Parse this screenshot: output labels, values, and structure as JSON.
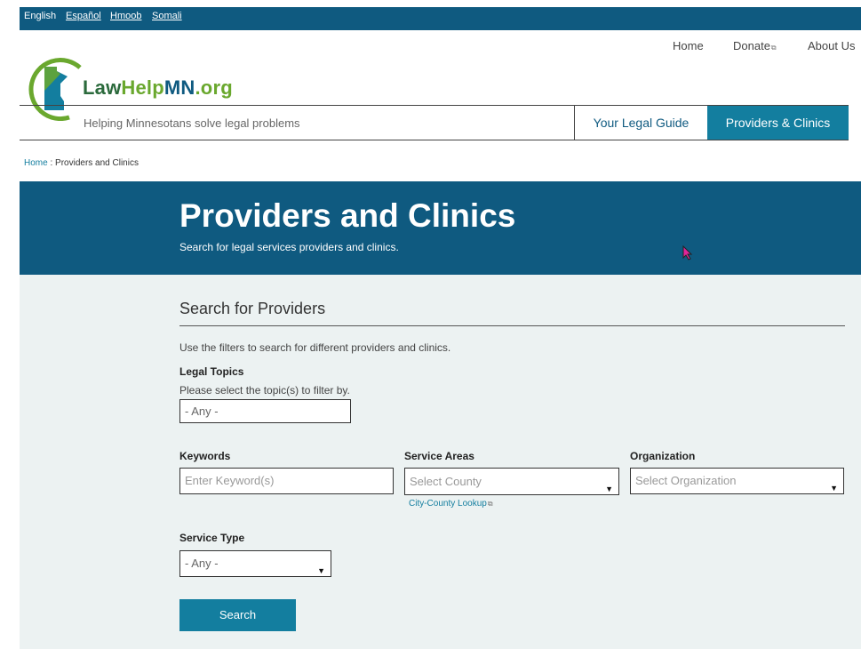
{
  "languages": [
    {
      "label": "English"
    },
    {
      "label": "Español"
    },
    {
      "label": "Hmoob"
    },
    {
      "label": "Somali"
    }
  ],
  "topnav": {
    "home": "Home",
    "donate": "Donate",
    "about": "About Us"
  },
  "brand": {
    "part1": "Law",
    "part2": "Help",
    "part3": "MN",
    "part4": ".org",
    "tagline": "Helping Minnesotans solve legal problems"
  },
  "tabs": {
    "guide": "Your Legal Guide",
    "providers": "Providers & Clinics"
  },
  "breadcrumb": {
    "home": "Home",
    "sep": ":",
    "current": "Providers and Clinics"
  },
  "hero": {
    "title": "Providers and Clinics",
    "subtitle": "Search for legal services providers and clinics."
  },
  "search": {
    "section_title": "Search for Providers",
    "intro": "Use the filters to search for different providers and clinics.",
    "topics": {
      "label": "Legal Topics",
      "hint": "Please select the topic(s) to filter by.",
      "value": "- Any -"
    },
    "keywords": {
      "label": "Keywords",
      "placeholder": "Enter Keyword(s)"
    },
    "service_areas": {
      "label": "Service Areas",
      "placeholder": "Select County",
      "lookup_link": "City-County Lookup"
    },
    "organization": {
      "label": "Organization",
      "placeholder": "Select Organization"
    },
    "service_type": {
      "label": "Service Type",
      "value": "- Any -"
    },
    "submit": "Search"
  },
  "colors": {
    "brand_dark": "#0f5a80",
    "brand_teal": "#137e9f",
    "panel_bg": "#ecf2f2",
    "logo_green": "#6aa82e"
  }
}
